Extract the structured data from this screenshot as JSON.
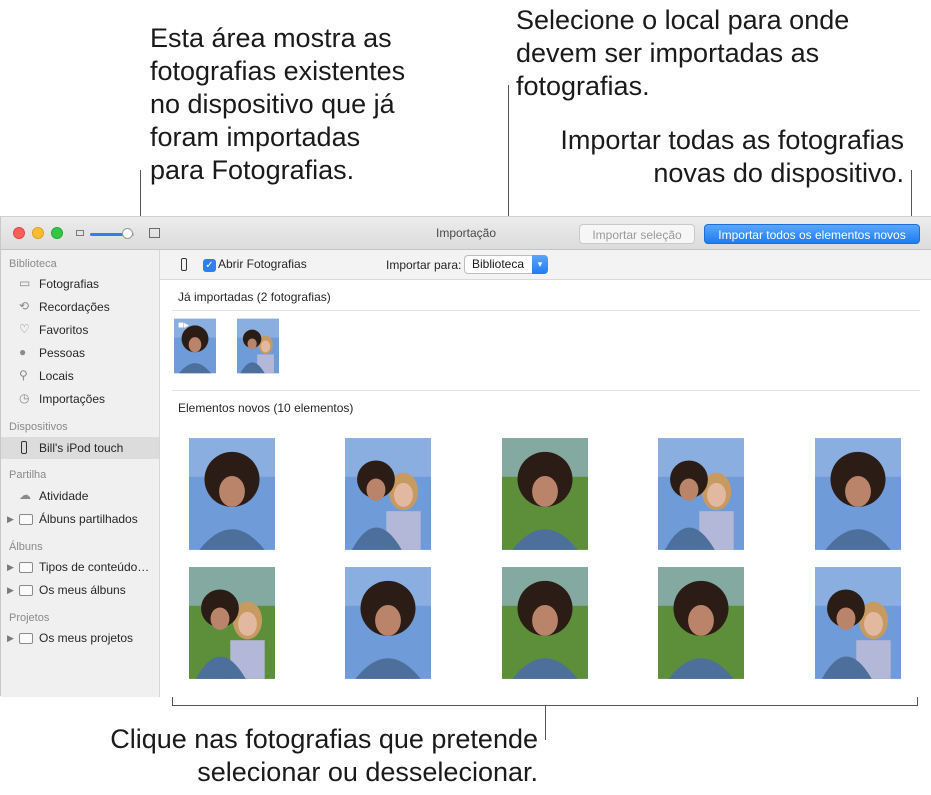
{
  "callouts": {
    "existing": "Esta área mostra as\nfotografias existentes\nno dispositivo que já\nforam importadas\npara Fotografias.",
    "destination": "Selecione o local para onde\ndevem ser importadas as\nfotografias.",
    "import_all": "Importar todas as fotografias\nnovas do dispositivo.",
    "select": "Clique nas fotografias que pretende\nselecionar ou desselecionar."
  },
  "window": {
    "title": "Importação",
    "import_selection_label": "Importar seleção",
    "import_all_label": "Importar todos os elementos novos"
  },
  "sidebar": {
    "library_header": "Biblioteca",
    "library_items": [
      "Fotografias",
      "Recordações",
      "Favoritos",
      "Pessoas",
      "Locais",
      "Importações"
    ],
    "devices_header": "Dispositivos",
    "device": "Bill's iPod touch",
    "sharing_header": "Partilha",
    "activity": "Atividade",
    "shared_albums": "Álbuns partilhados",
    "albums_header": "Álbuns",
    "media_types": "Tipos de conteúdo…",
    "my_albums": "Os meus álbuns",
    "projects_header": "Projetos",
    "my_projects": "Os meus projetos"
  },
  "toolbar": {
    "open_photos_label": "Abrir Fotografias",
    "open_photos_checked": true,
    "import_to_label": "Importar para:",
    "import_to_value": "Biblioteca"
  },
  "already_imported": {
    "title": "Já importadas (2 fotografias)",
    "count": 2
  },
  "new_items": {
    "title": "Elementos novos (10 elementos)",
    "count": 10
  },
  "colors": {
    "accent": "#2f7ff2",
    "sky": "#6f9bd8",
    "denim": "#4d6f9c",
    "hair": "#2b1d16",
    "skin": "#b9846a",
    "grass": "#5d8f3a"
  }
}
